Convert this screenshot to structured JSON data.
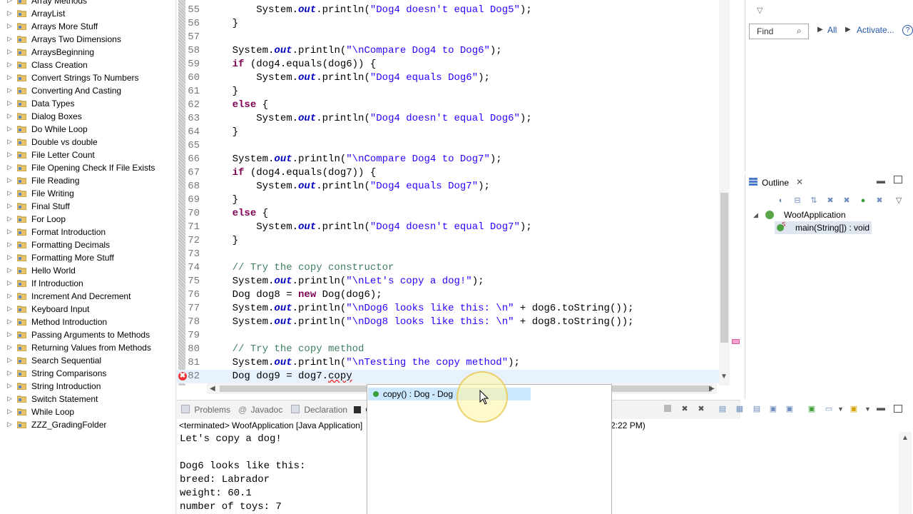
{
  "explorer": {
    "items": [
      "Array Methods",
      "ArrayList",
      "Arrays More Stuff",
      "Arrays Two Dimensions",
      "ArraysBeginning",
      "Class Creation",
      "Convert Strings To Numbers",
      "Converting And Casting",
      "Data Types",
      "Dialog Boxes",
      "Do While Loop",
      "Double vs double",
      "File Letter Count",
      "File Opening Check If File Exists",
      "File Reading",
      "File Writing",
      "Final Stuff",
      "For Loop",
      "Format Introduction",
      "Formatting Decimals",
      "Formatting More Stuff",
      "Hello World",
      "If Introduction",
      "Increment And Decrement",
      "Keyboard Input",
      "Method Introduction",
      "Passing Arguments to Methods",
      "Returning Values from Methods",
      "Search Sequential",
      "String Comparisons",
      "String Introduction",
      "Switch Statement",
      "While Loop",
      "ZZZ_GradingFolder"
    ]
  },
  "editor": {
    "lines": [
      {
        "num": "55",
        "text": "        System.out.println(\"Dog4 doesn't equal Dog5\");"
      },
      {
        "num": "56",
        "text": "    }"
      },
      {
        "num": "57",
        "text": ""
      },
      {
        "num": "58",
        "text": "    System.out.println(\"\\nCompare Dog4 to Dog6\");"
      },
      {
        "num": "59",
        "text": "    if (dog4.equals(dog6)) {"
      },
      {
        "num": "60",
        "text": "        System.out.println(\"Dog4 equals Dog6\");"
      },
      {
        "num": "61",
        "text": "    }"
      },
      {
        "num": "62",
        "text": "    else {"
      },
      {
        "num": "63",
        "text": "        System.out.println(\"Dog4 doesn't equal Dog6\");"
      },
      {
        "num": "64",
        "text": "    }"
      },
      {
        "num": "65",
        "text": ""
      },
      {
        "num": "66",
        "text": "    System.out.println(\"\\nCompare Dog4 to Dog7\");"
      },
      {
        "num": "67",
        "text": "    if (dog4.equals(dog7)) {"
      },
      {
        "num": "68",
        "text": "        System.out.println(\"Dog4 equals Dog7\");"
      },
      {
        "num": "69",
        "text": "    }"
      },
      {
        "num": "70",
        "text": "    else {"
      },
      {
        "num": "71",
        "text": "        System.out.println(\"Dog4 doesn't equal Dog7\");"
      },
      {
        "num": "72",
        "text": "    }"
      },
      {
        "num": "73",
        "text": ""
      },
      {
        "num": "74",
        "text": "    // Try the copy constructor"
      },
      {
        "num": "75",
        "text": "    System.out.println(\"\\nLet's copy a dog!\");"
      },
      {
        "num": "76",
        "text": "    Dog dog8 = new Dog(dog6);"
      },
      {
        "num": "77",
        "text": "    System.out.println(\"\\nDog6 looks like this: \\n\" + dog6.toString());"
      },
      {
        "num": "78",
        "text": "    System.out.println(\"\\nDog8 looks like this: \\n\" + dog8.toString());"
      },
      {
        "num": "79",
        "text": ""
      },
      {
        "num": "80",
        "text": "    // Try the copy method"
      },
      {
        "num": "81",
        "text": "    System.out.println(\"\\nTesting the copy method\");"
      },
      {
        "num": "82",
        "text": "    Dog dog9 = dog7.copy"
      }
    ]
  },
  "right_panel": {
    "find_placeholder": "Find",
    "all_label": "All",
    "activate_label": "Activate...",
    "help_label": "?"
  },
  "outline": {
    "tab_label": "Outline",
    "class_name": "WoofApplication",
    "method_label": "main(String[]) : void",
    "method_badge": "S"
  },
  "bottom_tabs": {
    "problems": "Problems",
    "javadoc": "Javadoc",
    "declaration": "Declaration",
    "console": "C"
  },
  "console": {
    "header_left": "<terminated> WoofApplication [Java Application]",
    "header_right": "2:22 PM)",
    "lines": [
      "Let's copy a dog!",
      "",
      "Dog6 looks like this:",
      "breed: Labrador",
      "weight: 60.1",
      "number of toys: 7"
    ]
  },
  "assist": {
    "item_label": "copy() : Dog - Dog"
  },
  "colors": {
    "keyword": "#7f0055",
    "string": "#2a00ff",
    "comment": "#3f7f5f",
    "field": "#0000c0",
    "selection": "#cce8ff"
  }
}
